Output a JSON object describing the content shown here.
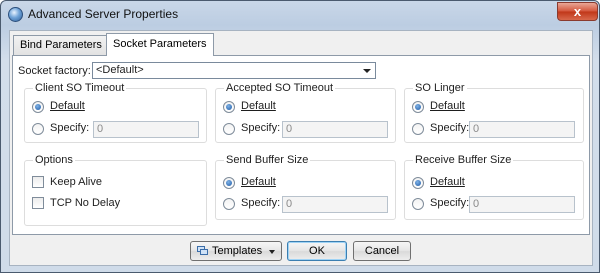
{
  "window": {
    "title": "Advanced Server Properties",
    "close_glyph": "x"
  },
  "tabs": [
    {
      "label": "Bind Parameters",
      "active": false
    },
    {
      "label": "Socket Parameters",
      "active": true
    }
  ],
  "socket_factory": {
    "label": "Socket factory:",
    "value": "<Default>"
  },
  "groups": {
    "client_so_timeout": {
      "title": "Client SO Timeout",
      "default_label": "Default",
      "specify_label": "Specify:",
      "specify_value": "0",
      "selected": "default"
    },
    "accepted_so_timeout": {
      "title": "Accepted SO Timeout",
      "default_label": "Default",
      "specify_label": "Specify:",
      "specify_value": "0",
      "selected": "default"
    },
    "so_linger": {
      "title": "SO Linger",
      "default_label": "Default",
      "specify_label": "Specify:",
      "specify_value": "0",
      "selected": "default"
    },
    "options": {
      "title": "Options",
      "keep_alive_label": "Keep Alive",
      "keep_alive_checked": false,
      "tcp_no_delay_label": "TCP No Delay",
      "tcp_no_delay_checked": false
    },
    "send_buffer_size": {
      "title": "Send Buffer Size",
      "default_label": "Default",
      "specify_label": "Specify:",
      "specify_value": "0",
      "selected": "default"
    },
    "receive_buffer_size": {
      "title": "Receive Buffer Size",
      "default_label": "Default",
      "specify_label": "Specify:",
      "specify_value": "0",
      "selected": "default"
    }
  },
  "buttons": {
    "templates": "Templates",
    "ok": "OK",
    "cancel": "Cancel"
  },
  "icons": {
    "window": "server-icon",
    "templates": "templates-icon",
    "close": "close-icon"
  }
}
